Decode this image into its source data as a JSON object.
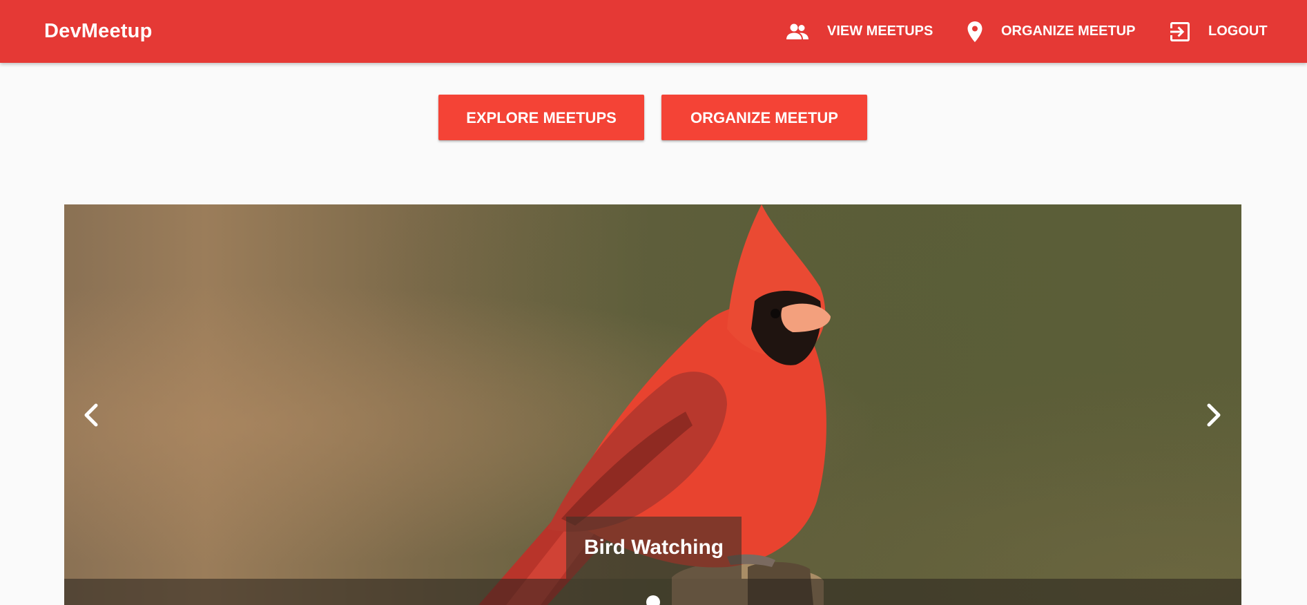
{
  "app": {
    "title": "DevMeetup"
  },
  "nav": {
    "items": [
      {
        "label": "VIEW MEETUPS",
        "icon": "supervisor-account-icon"
      },
      {
        "label": "ORGANIZE MEETUP",
        "icon": "location-pin-icon"
      },
      {
        "label": "LOGOUT",
        "icon": "exit-to-app-icon"
      }
    ]
  },
  "actions": {
    "explore_label": "EXPLORE MEETUPS",
    "organize_label": "ORGANIZE MEETUP"
  },
  "carousel": {
    "slide_title": "Bird Watching",
    "slide_count": 1,
    "active_index": 0
  },
  "colors": {
    "toolbar": "#e53935",
    "button": "#f44336",
    "background": "#fafafa"
  }
}
